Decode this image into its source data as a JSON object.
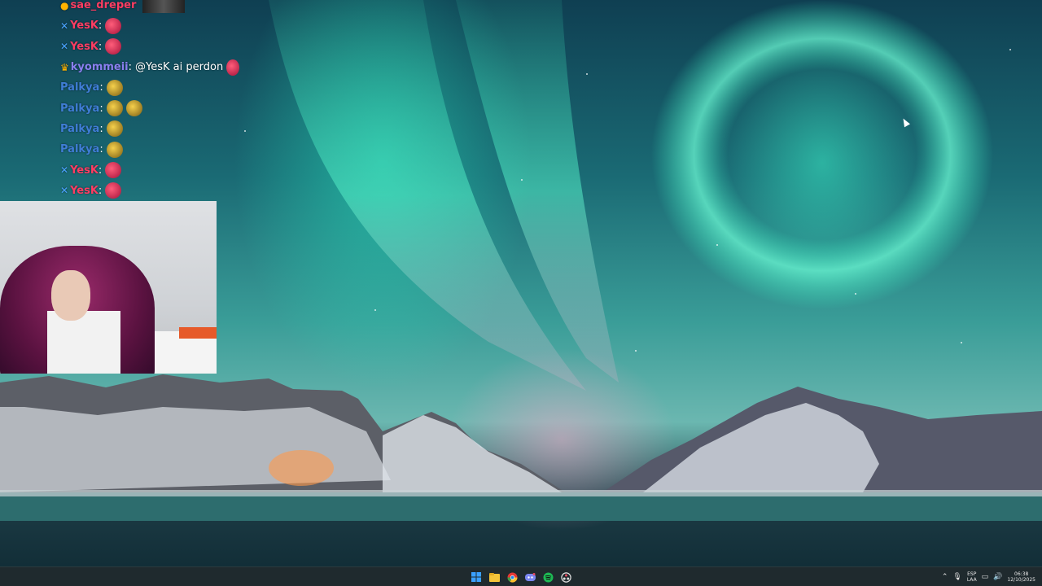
{
  "chat": {
    "messages": [
      {
        "badge": "vip",
        "badge_icon": "bits-icon",
        "user": "sae_dreper",
        "user_color": "red",
        "sep": "",
        "text": "",
        "emotes": [],
        "thumb": true
      },
      {
        "badge": "mod",
        "badge_icon": "sword-icon",
        "user": "YesK",
        "user_color": "red",
        "sep": ":",
        "text": "",
        "emotes": [
          "red"
        ],
        "thumb": false
      },
      {
        "badge": "mod",
        "badge_icon": "sword-icon",
        "user": "YesK",
        "user_color": "red",
        "sep": ":",
        "text": "",
        "emotes": [
          "red"
        ],
        "thumb": false
      },
      {
        "badge": "vip",
        "badge_icon": "crown-icon",
        "user": "kyommeii",
        "user_color": "purple",
        "sep": ":",
        "text": "@YesK ai perdon",
        "emotes": [
          "red"
        ],
        "thumb": false
      },
      {
        "badge": "",
        "badge_icon": "",
        "user": "Palkya",
        "user_color": "blue",
        "sep": ":",
        "text": "",
        "emotes": [
          "yellow"
        ],
        "thumb": false
      },
      {
        "badge": "",
        "badge_icon": "",
        "user": "Palkya",
        "user_color": "blue",
        "sep": ":",
        "text": "",
        "emotes": [
          "yellow",
          "yellow"
        ],
        "thumb": false
      },
      {
        "badge": "",
        "badge_icon": "",
        "user": "Palkya",
        "user_color": "blue",
        "sep": ":",
        "text": "",
        "emotes": [
          "yellow"
        ],
        "thumb": false
      },
      {
        "badge": "",
        "badge_icon": "",
        "user": "Palkya",
        "user_color": "blue",
        "sep": ":",
        "text": "",
        "emotes": [
          "yellow"
        ],
        "thumb": false
      },
      {
        "badge": "mod",
        "badge_icon": "sword-icon",
        "user": "YesK",
        "user_color": "red",
        "sep": ":",
        "text": "",
        "emotes": [
          "red"
        ],
        "thumb": false
      },
      {
        "badge": "mod",
        "badge_icon": "sword-icon",
        "user": "YesK",
        "user_color": "red",
        "sep": ":",
        "text": "",
        "emotes": [
          "red"
        ],
        "thumb": false
      }
    ]
  },
  "taskbar": {
    "apps": [
      {
        "name": "start-icon",
        "color": "#3aa0ff"
      },
      {
        "name": "file-explorer-icon",
        "color": "#f3c43a"
      },
      {
        "name": "chrome-icon",
        "color": "#e5e5e5"
      },
      {
        "name": "discord-icon",
        "color": "#7a86f0"
      },
      {
        "name": "spotify-icon",
        "color": "#1db954"
      },
      {
        "name": "obs-icon",
        "color": "#e84a5f"
      }
    ],
    "tray": {
      "language_top": "ESP",
      "language_bottom": "LAA",
      "time": "06:38",
      "date": "12/10/2025"
    }
  }
}
